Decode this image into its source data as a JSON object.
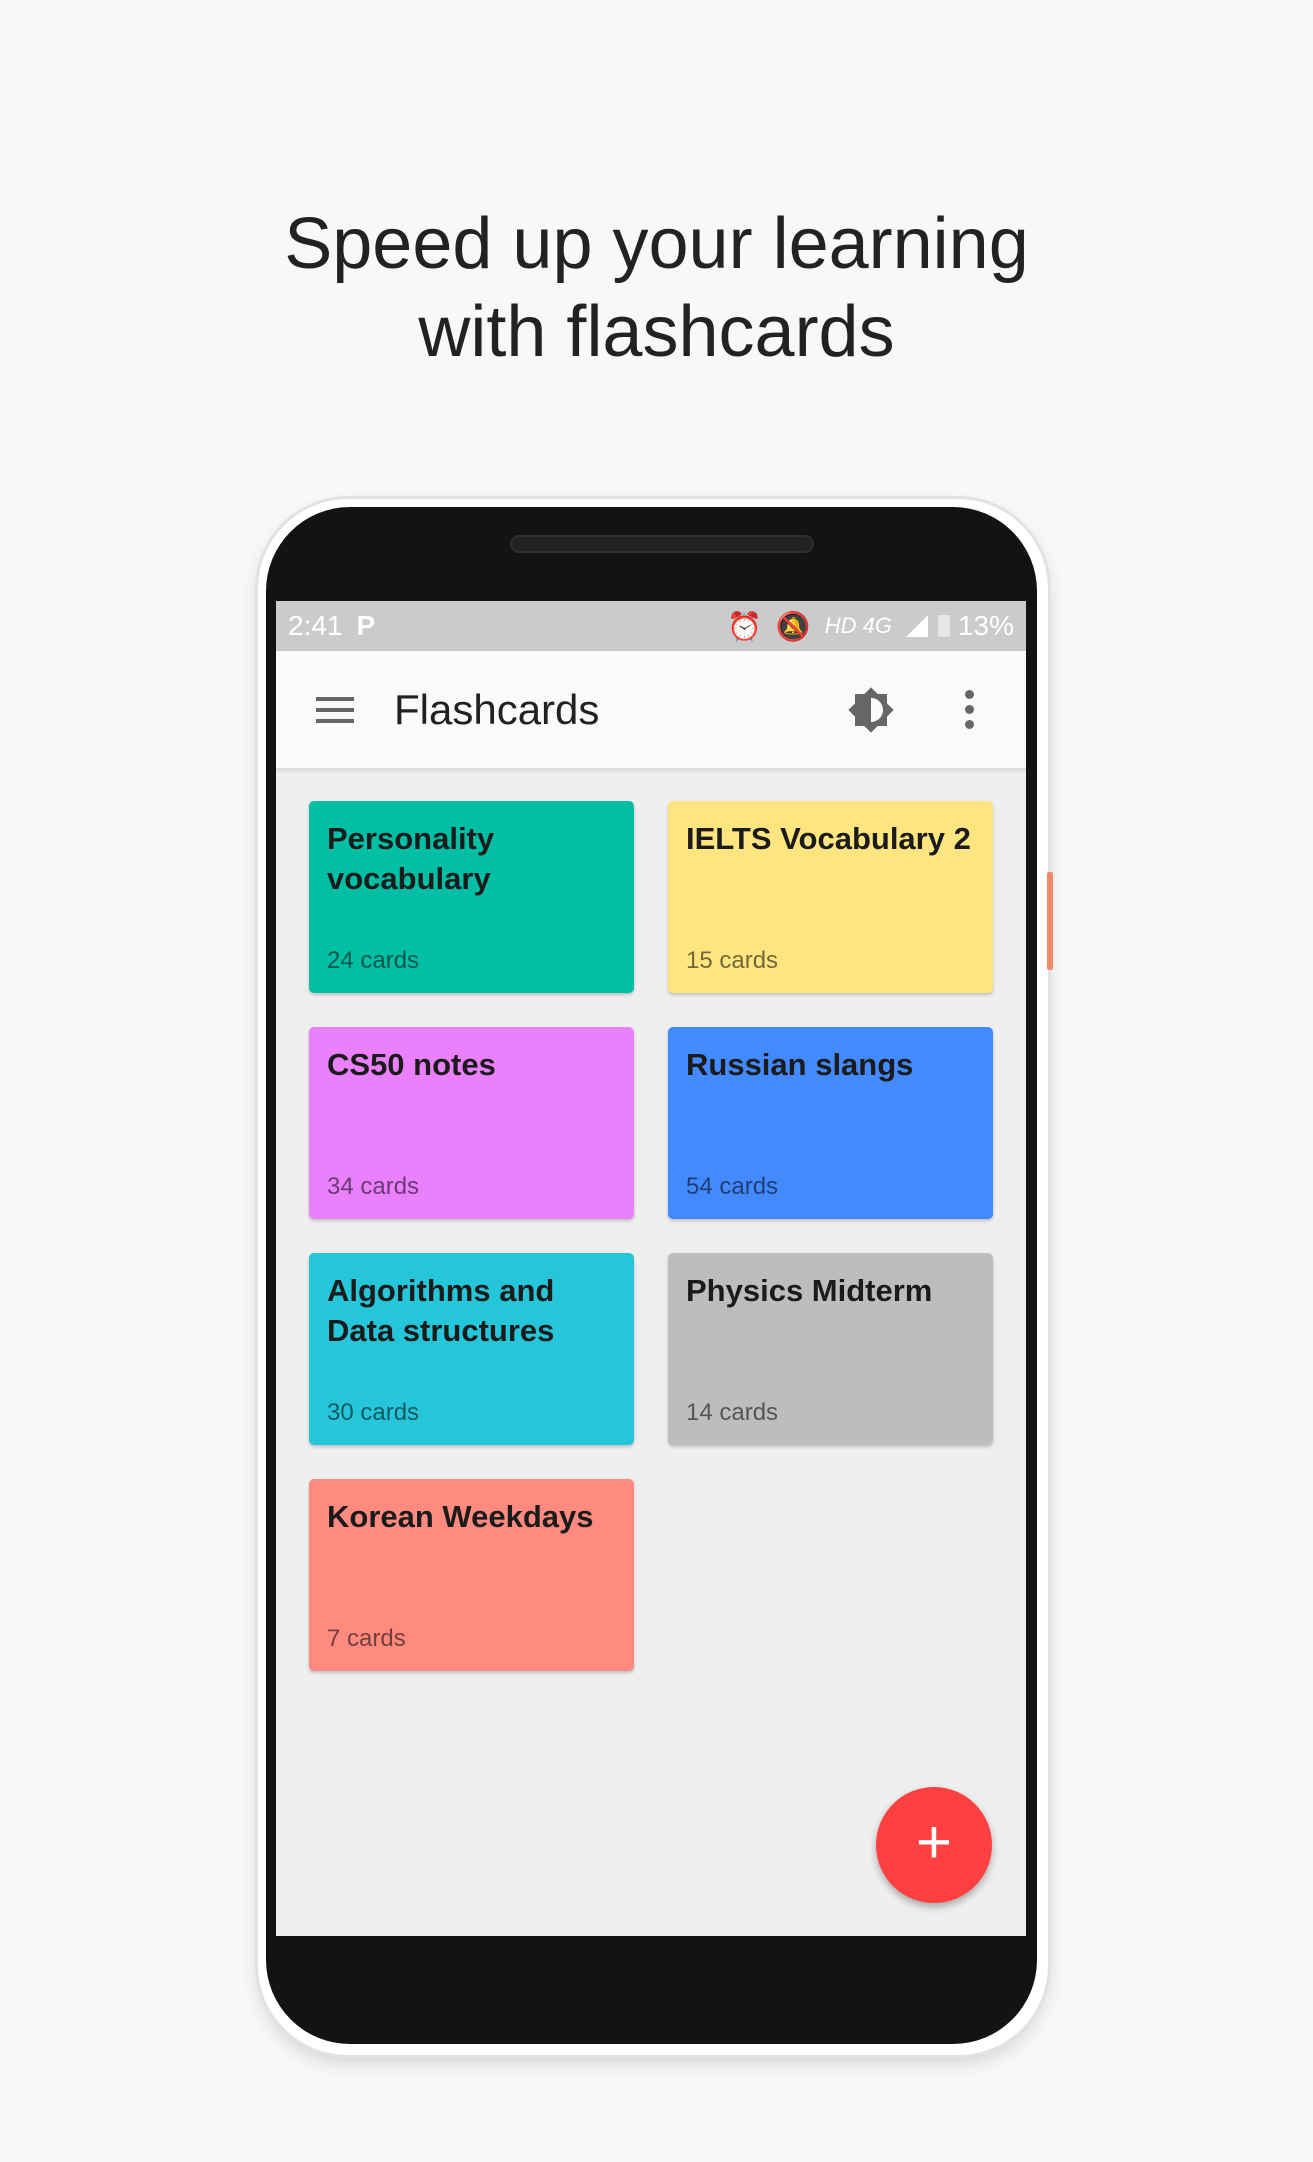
{
  "headline": {
    "line1": "Speed up your learning",
    "line2": "with flashcards"
  },
  "status_bar": {
    "time": "2:41",
    "app_icon": "P",
    "network": "HD 4G",
    "battery": "13%",
    "icons": [
      "alarm-icon",
      "notifications-off-icon",
      "signal-icon",
      "battery-charging-icon"
    ]
  },
  "app_bar": {
    "title": "Flashcards",
    "icons": [
      "menu-icon",
      "brightness-icon",
      "more-vert-icon"
    ]
  },
  "decks": [
    {
      "title": "Personality vocabulary",
      "count": "24 cards",
      "color": "#00BFA5"
    },
    {
      "title": "IELTS Vocabulary 2",
      "count": "15 cards",
      "color": "#FFE57F"
    },
    {
      "title": "CS50 notes",
      "count": "34 cards",
      "color": "#EA80FC"
    },
    {
      "title": "Russian slangs",
      "count": "54 cards",
      "color": "#448AFF"
    },
    {
      "title": "Algorithms and Data structures",
      "count": "30 cards",
      "color": "#26C6DA"
    },
    {
      "title": "Physics Midterm",
      "count": "14 cards",
      "color": "#BDBDBD"
    },
    {
      "title": "Korean Weekdays",
      "count": "7 cards",
      "color": "#FF8A80"
    }
  ],
  "fab": {
    "label": "+",
    "color": "#FF4040"
  }
}
